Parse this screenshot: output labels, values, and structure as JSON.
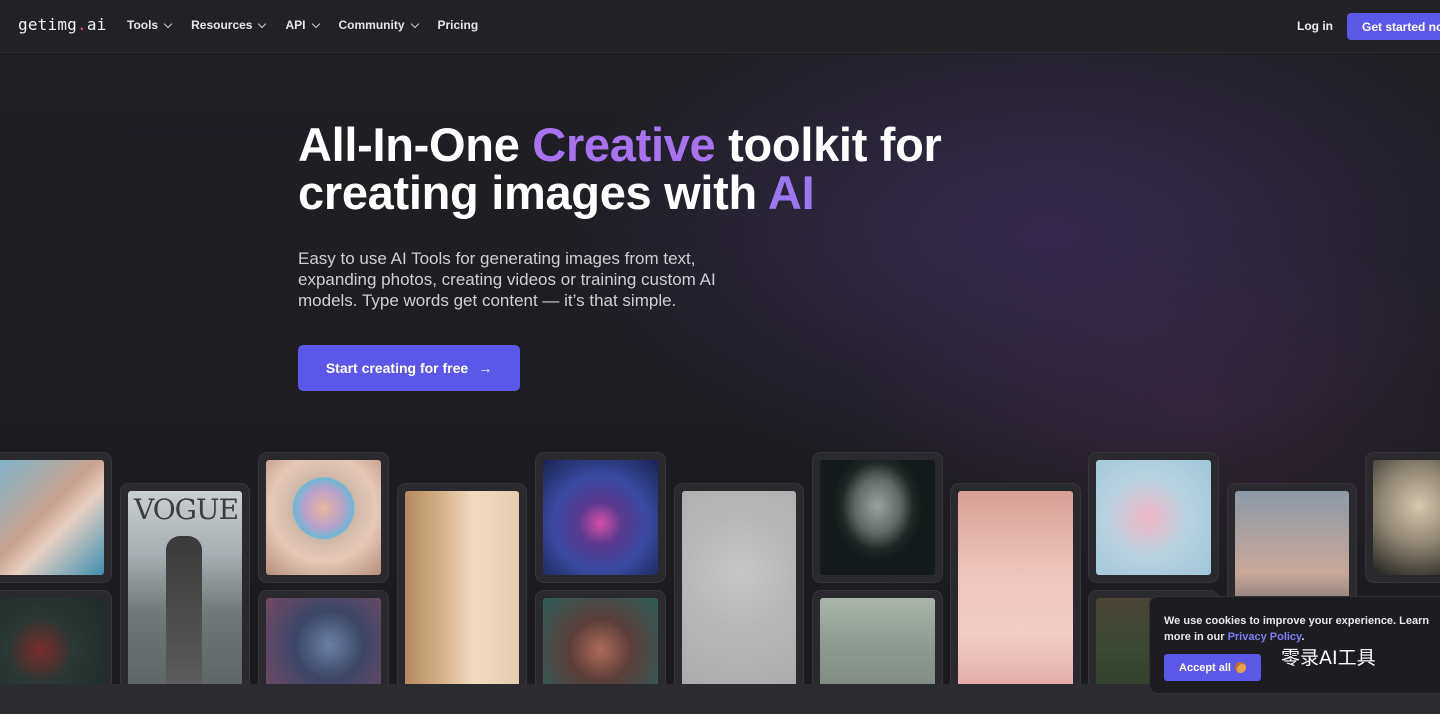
{
  "nav": {
    "logo_main": "getimg",
    "logo_dot": ".",
    "logo_tld": "ai",
    "menu": [
      "Tools",
      "Resources",
      "API",
      "Community"
    ],
    "pricing": "Pricing",
    "login": "Log in",
    "get_started": "Get started now"
  },
  "hero": {
    "headline_1": "All-In-One ",
    "headline_accent1": "Creative",
    "headline_2": " toolkit for",
    "headline_3": "creating images with ",
    "headline_accent2": "AI",
    "sub": "Easy to use AI Tools for generating images from text, expanding photos, creating videos or training custom AI models. Type words get content — it’s that simple.",
    "cta": "Start creating for free",
    "cta_icon": "arrow-right-icon"
  },
  "gallery": {
    "vogue_text": "VOGUE"
  },
  "cookie": {
    "text": "We use cookies to improve your experience. Learn more in our ",
    "link": "Privacy Policy",
    "period": ".",
    "accept": "Accept all",
    "accept_icon": "cookie-icon"
  },
  "watermark": "零录AI工具",
  "colors": {
    "accent": "#5b57e8",
    "headline_accent": "#a773f0",
    "link": "#7f7cf5",
    "background": "#1b1b1f"
  }
}
